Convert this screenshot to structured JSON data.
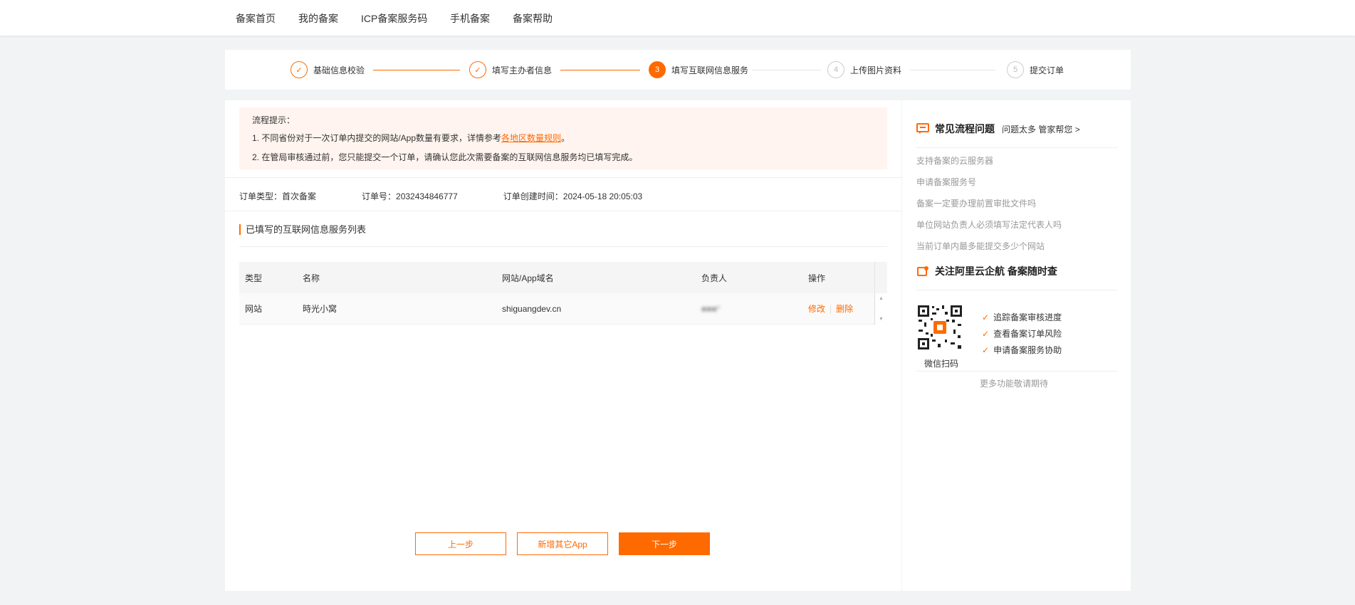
{
  "nav": {
    "items": [
      "备案首页",
      "我的备案",
      "ICP备案服务码",
      "手机备案",
      "备案帮助"
    ]
  },
  "steps": [
    {
      "num": "✓",
      "label": "基础信息校验",
      "state": "done"
    },
    {
      "num": "✓",
      "label": "填写主办者信息",
      "state": "done"
    },
    {
      "num": "3",
      "label": "填写互联网信息服务",
      "state": "active"
    },
    {
      "num": "4",
      "label": "上传图片资料",
      "state": "todo"
    },
    {
      "num": "5",
      "label": "提交订单",
      "state": "todo"
    }
  ],
  "tips": {
    "title": "流程提示：",
    "line1_prefix": "1. 不同省份对于一次订单内提交的网站/App数量有要求，详情参考",
    "line1_link": "各地区数量规则",
    "line1_suffix": "。",
    "line2": "2. 在管局审核通过前，您只能提交一个订单，请确认您此次需要备案的互联网信息服务均已填写完成。"
  },
  "order": {
    "type": "订单类型：首次备案",
    "number": "订单号：2032434846777",
    "created": "订单创建时间：2024-05-18 20:05:03"
  },
  "section_title": "已填写的互联网信息服务列表",
  "table": {
    "headers": [
      "类型",
      "名称",
      "网站/App域名",
      "负责人",
      "操作"
    ],
    "rows": [
      {
        "type": "网站",
        "name": "時光小窝",
        "domain": "shiguangdev.cn",
        "owner": "■■■*",
        "edit": "修改",
        "delete": "删除"
      }
    ]
  },
  "buttons": {
    "prev": "上一步",
    "add_app": "新增其它App",
    "next": "下一步"
  },
  "side": {
    "faq_title": "常见流程问题",
    "faq_sub": "问题太多 管家帮您",
    "faq_items": [
      "支持备案的云服务器",
      "申请备案服务号",
      "备案一定要办理前置审批文件吗",
      "单位网站负责人必须填写法定代表人吗",
      "当前订单内最多能提交多少个网站"
    ],
    "follow_title": "关注阿里云企航 备案随时查",
    "qr_caption": "微信扫码",
    "features": [
      "追踪备案审核进度",
      "查看备案订单风险",
      "申请备案服务协助"
    ],
    "more": "更多功能敬请期待"
  },
  "colors": {
    "accent": "#ff6a00",
    "tips_bg": "#fff4ef",
    "page_bg": "#f2f3f5"
  }
}
